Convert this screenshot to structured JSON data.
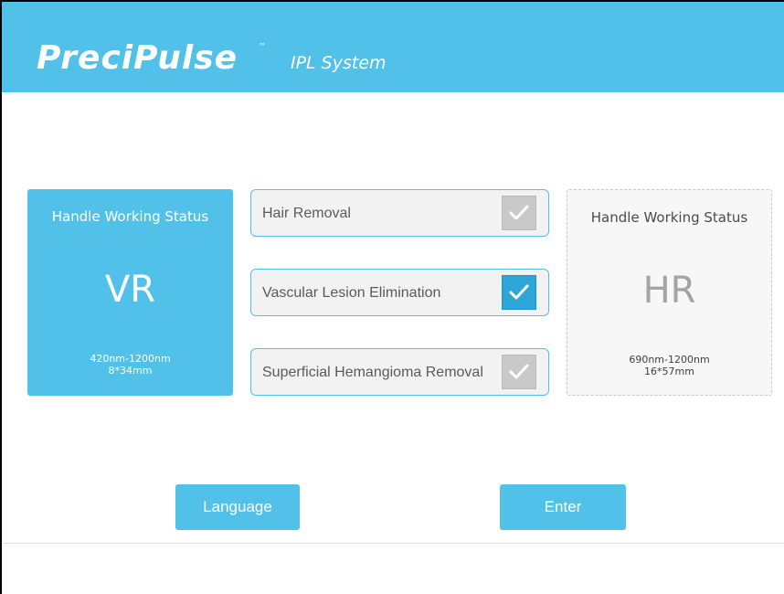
{
  "header": {
    "brand": "PreciPulse",
    "trademark": "™",
    "subtitle": "IPL System",
    "background_color": "#52c1ea"
  },
  "left_handle": {
    "title": "Handle Working Status",
    "code": "VR",
    "wavelength": "420nm-1200nm",
    "spot_size": "8*34mm",
    "state": "active"
  },
  "right_handle": {
    "title": "Handle Working Status",
    "code": "HR",
    "wavelength": "690nm-1200nm",
    "spot_size": "16*57mm",
    "state": "inactive"
  },
  "options": [
    {
      "label": "Hair Removal",
      "checked": false
    },
    {
      "label": "Vascular Lesion Elimination",
      "checked": true
    },
    {
      "label": "Superficial Hemangioma Removal",
      "checked": false
    }
  ],
  "buttons": {
    "language": "Language",
    "enter": "Enter"
  },
  "colors": {
    "accent": "#52c1ea",
    "checked": "#2ea6d8",
    "unchecked": "#c9c9c9"
  }
}
